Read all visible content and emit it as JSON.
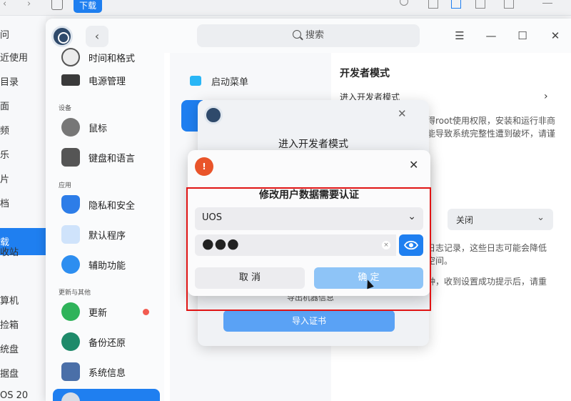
{
  "file_manager": {
    "nav": {
      "back": "‹",
      "forward": "›"
    },
    "download_tab": "下载",
    "sidebar_items": [
      "问",
      "近使用",
      "目录",
      "面",
      "频",
      "乐",
      "片",
      "档",
      "载",
      "收站",
      "算机",
      "捡箱",
      "统盘",
      "据盘",
      "OS 20"
    ]
  },
  "control_center": {
    "search_placeholder": "搜索",
    "window_buttons": {
      "menu": "☰",
      "minimize": "—",
      "maximize": "☐",
      "close": "✕"
    },
    "nav": {
      "items_top": [
        {
          "label": "时间和格式",
          "icon": "clock-icon"
        },
        {
          "label": "电源管理",
          "icon": "battery-icon"
        }
      ],
      "group_device": "设备",
      "items_device": [
        {
          "label": "鼠标",
          "icon": "mouse-icon"
        },
        {
          "label": "键盘和语言",
          "icon": "keyboard-icon"
        }
      ],
      "group_apps": "应用",
      "items_apps": [
        {
          "label": "隐私和安全",
          "icon": "shield-icon"
        },
        {
          "label": "默认程序",
          "icon": "default-apps-icon"
        },
        {
          "label": "辅助功能",
          "icon": "accessibility-icon"
        }
      ],
      "group_other": "更新与其他",
      "items_other": [
        {
          "label": "更新",
          "icon": "update-icon"
        },
        {
          "label": "备份还原",
          "icon": "backup-icon"
        },
        {
          "label": "系统信息",
          "icon": "system-info-icon"
        }
      ]
    },
    "middle": {
      "boot_menu": "启动菜单"
    },
    "right": {
      "heading": "开发者模式",
      "enter_dev": "进入开发者模式",
      "desc_line1": "获得root使用权限，安装和运行非商",
      "desc_line2": "可能导致系统完整性遭到破坏，请谨",
      "log_select": "关闭",
      "log_desc1": "的日志记录，这些日志可能会降低",
      "log_desc2": "盘空间。",
      "log_desc3": "分钟，收到设置成功提示后，请重"
    }
  },
  "dev_dialog": {
    "title": "进入开发者模式",
    "export_info": "导出机器信息",
    "import_cert": "导入证书"
  },
  "auth_dialog": {
    "title": "修改用户数据需要认证",
    "user": "UOS",
    "password": "●●●",
    "cancel": "取 消",
    "confirm": "确 定"
  },
  "colors": {
    "accent": "#1f7ff0",
    "highlight": "#e01414"
  }
}
